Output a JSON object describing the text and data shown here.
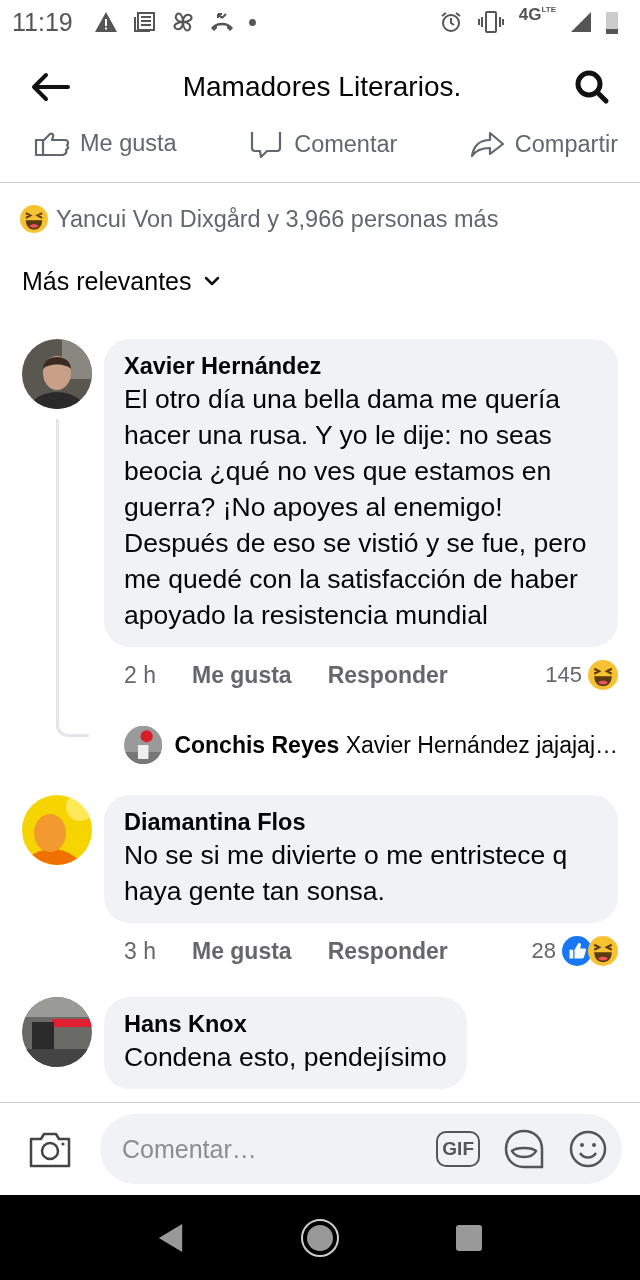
{
  "status_bar": {
    "time": "11:19",
    "network": "4G",
    "network_sub": "LTE"
  },
  "header": {
    "title": "Mamadores Literarios."
  },
  "post_actions": [
    {
      "kind": "like",
      "label": "Me gusta"
    },
    {
      "kind": "comment",
      "label": "Comentar"
    },
    {
      "kind": "share",
      "label": "Compartir"
    }
  ],
  "reactions_summary": {
    "text": "Yancui Von Dixgård y 3,966 personas más"
  },
  "sort": {
    "label": "Más relevantes"
  },
  "comments": [
    {
      "author": "Xavier Hernández",
      "text": "El otro día una bella dama me quería hacer una rusa. Y yo le dije: no seas beocia ¿qué no ves que estamos en guerra? ¡No apoyes al enemigo! Después de eso se vistió y se fue, pero me quedé con la satisfacción de haber apoyado la resistencia mundial",
      "time": "2 h",
      "like_label": "Me gusta",
      "reply_label": "Responder",
      "reaction_count": "145",
      "reactions": [
        {
          "kind": "haha"
        }
      ],
      "replies": [
        {
          "author": "Conchis Reyes",
          "text": "Xavier Hernández jajajaj…"
        }
      ]
    },
    {
      "author": "Diamantina Flos",
      "text": "No se si me divierte o me entristece q haya gente tan sonsa.",
      "time": "3 h",
      "like_label": "Me gusta",
      "reply_label": "Responder",
      "reaction_count": "28",
      "reactions": [
        {
          "kind": "like"
        },
        {
          "kind": "haha"
        }
      ]
    },
    {
      "author": "Hans Knox",
      "text": "Condena esto, pendejísimo"
    }
  ],
  "composer": {
    "placeholder": "Comentar…",
    "gif_label": "GIF"
  }
}
